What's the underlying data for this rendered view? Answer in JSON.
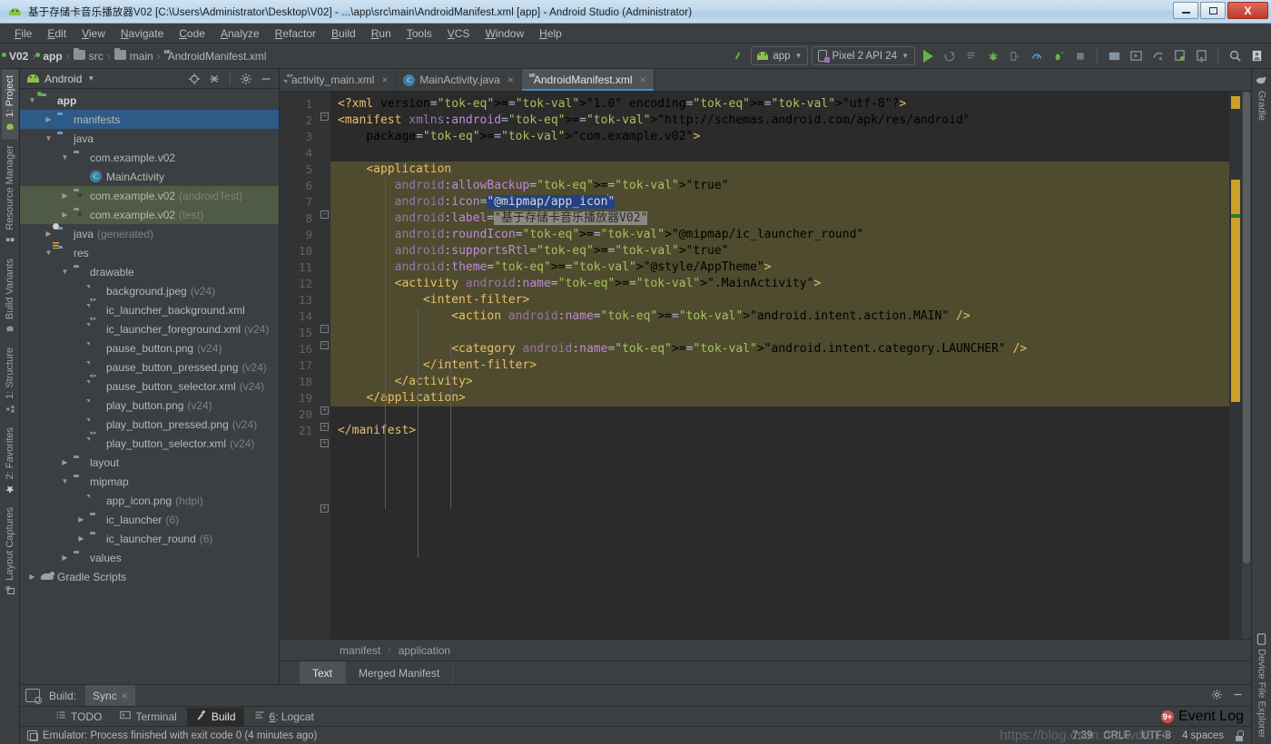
{
  "window": {
    "title": "基于存储卡音乐播放器V02 [C:\\Users\\Administrator\\Desktop\\V02] - ...\\app\\src\\main\\AndroidManifest.xml [app] - Android Studio (Administrator)",
    "minimize_label": "",
    "maximize_label": "",
    "close_label": "X"
  },
  "menu": {
    "items": [
      "File",
      "Edit",
      "View",
      "Navigate",
      "Code",
      "Analyze",
      "Refactor",
      "Build",
      "Run",
      "Tools",
      "VCS",
      "Window",
      "Help"
    ]
  },
  "toolbar": {
    "breadcrumbs": [
      {
        "label": "V02",
        "icon": "module-icon",
        "bold": true
      },
      {
        "label": "app",
        "icon": "module-icon",
        "bold": true
      },
      {
        "label": "src",
        "icon": "folder-icon",
        "bold": false
      },
      {
        "label": "main",
        "icon": "folder-icon",
        "bold": false
      },
      {
        "label": "AndroidManifest.xml",
        "icon": "manifest-icon",
        "bold": false
      }
    ],
    "separator": "›",
    "run_config": "app",
    "device": "Pixel 2 API 24",
    "caret": "▼",
    "icons": [
      "make-project-icon",
      "run-icon",
      "apply-changes-icon",
      "apply-code-changes-icon",
      "debug-icon",
      "attach-debugger-icon",
      "profile-icon",
      "run-coverage-icon",
      "stop-icon",
      "sdk-manager-icon",
      "avd-manager-icon",
      "sync-gradle-icon",
      "device-manager-icon",
      "layout-inspector-icon",
      "search-icon",
      "user-icon"
    ]
  },
  "left_toolbar": {
    "tabs": [
      {
        "label": "1: Project",
        "icon": "project-icon",
        "selected": true
      },
      {
        "label": "Resource Manager",
        "icon": "resource-icon",
        "selected": false
      },
      {
        "label": "Build Variants",
        "icon": "variants-icon",
        "selected": false
      },
      {
        "label": "1: Structure",
        "icon": "structure-icon",
        "selected": false
      },
      {
        "label": "2: Favorites",
        "icon": "star-icon",
        "selected": false
      },
      {
        "label": "Layout Captures",
        "icon": "capture-icon",
        "selected": false
      }
    ]
  },
  "right_toolbar": {
    "tabs": [
      {
        "label": "Gradle",
        "icon": "gradle-icon"
      },
      {
        "label": "Device File Explorer",
        "icon": "device-icon"
      }
    ]
  },
  "project_panel": {
    "title": "Android",
    "caret": "▼",
    "header_icons": [
      "locate-icon",
      "collapse-all-icon",
      "settings-gear-icon",
      "hide-icon"
    ],
    "tree": [
      {
        "indent": 0,
        "arrow": "▼",
        "icon": "module-icon",
        "label": "app",
        "hint": "",
        "bold": true,
        "state": "none"
      },
      {
        "indent": 1,
        "arrow": "▶",
        "icon": "folder-icon",
        "label": "manifests",
        "hint": "",
        "bold": false,
        "state": "selected-blue"
      },
      {
        "indent": 1,
        "arrow": "▼",
        "icon": "folder-icon",
        "label": "java",
        "hint": "",
        "bold": false,
        "state": "none"
      },
      {
        "indent": 2,
        "arrow": "▼",
        "icon": "package-icon",
        "label": "com.example.v02",
        "hint": "",
        "bold": false,
        "state": "none"
      },
      {
        "indent": 3,
        "arrow": "",
        "icon": "class-icon",
        "label": "MainActivity",
        "hint": "",
        "bold": false,
        "state": "none"
      },
      {
        "indent": 2,
        "arrow": "▶",
        "icon": "package-icon",
        "label": "com.example.v02",
        "hint": "(androidTest)",
        "bold": false,
        "state": "selected-green"
      },
      {
        "indent": 2,
        "arrow": "▶",
        "icon": "package-icon",
        "label": "com.example.v02",
        "hint": "(test)",
        "bold": false,
        "state": "selected-green"
      },
      {
        "indent": 1,
        "arrow": "▶",
        "icon": "generated-icon",
        "label": "java",
        "hint": "(generated)",
        "bold": false,
        "state": "none"
      },
      {
        "indent": 1,
        "arrow": "▼",
        "icon": "res-icon",
        "label": "res",
        "hint": "",
        "bold": false,
        "state": "none"
      },
      {
        "indent": 2,
        "arrow": "▼",
        "icon": "package-icon",
        "label": "drawable",
        "hint": "",
        "bold": false,
        "state": "none"
      },
      {
        "indent": 3,
        "arrow": "",
        "icon": "image-file-icon",
        "label": "background.jpeg",
        "hint": "(v24)",
        "bold": false,
        "state": "none"
      },
      {
        "indent": 3,
        "arrow": "",
        "icon": "xml-file-icon",
        "label": "ic_launcher_background.xml",
        "hint": "",
        "bold": false,
        "state": "none"
      },
      {
        "indent": 3,
        "arrow": "",
        "icon": "xml-file-icon",
        "label": "ic_launcher_foreground.xml",
        "hint": "(v24)",
        "bold": false,
        "state": "none"
      },
      {
        "indent": 3,
        "arrow": "",
        "icon": "image-file-icon",
        "label": "pause_button.png",
        "hint": "(v24)",
        "bold": false,
        "state": "none"
      },
      {
        "indent": 3,
        "arrow": "",
        "icon": "image-file-icon",
        "label": "pause_button_pressed.png",
        "hint": "(v24)",
        "bold": false,
        "state": "none"
      },
      {
        "indent": 3,
        "arrow": "",
        "icon": "xml-file-icon",
        "label": "pause_button_selector.xml",
        "hint": "(v24)",
        "bold": false,
        "state": "none"
      },
      {
        "indent": 3,
        "arrow": "",
        "icon": "image-file-icon",
        "label": "play_button.png",
        "hint": "(v24)",
        "bold": false,
        "state": "none"
      },
      {
        "indent": 3,
        "arrow": "",
        "icon": "image-file-icon",
        "label": "play_button_pressed.png",
        "hint": "(v24)",
        "bold": false,
        "state": "none"
      },
      {
        "indent": 3,
        "arrow": "",
        "icon": "xml-file-icon",
        "label": "play_button_selector.xml",
        "hint": "(v24)",
        "bold": false,
        "state": "none"
      },
      {
        "indent": 2,
        "arrow": "▶",
        "icon": "package-icon",
        "label": "layout",
        "hint": "",
        "bold": false,
        "state": "none"
      },
      {
        "indent": 2,
        "arrow": "▼",
        "icon": "package-icon",
        "label": "mipmap",
        "hint": "",
        "bold": false,
        "state": "none"
      },
      {
        "indent": 3,
        "arrow": "",
        "icon": "image-file-icon",
        "label": "app_icon.png",
        "hint": "(hdpi)",
        "bold": false,
        "state": "none"
      },
      {
        "indent": 3,
        "arrow": "▶",
        "icon": "package-icon",
        "label": "ic_launcher",
        "hint": "(6)",
        "bold": false,
        "state": "none"
      },
      {
        "indent": 3,
        "arrow": "▶",
        "icon": "package-icon",
        "label": "ic_launcher_round",
        "hint": "(6)",
        "bold": false,
        "state": "none"
      },
      {
        "indent": 2,
        "arrow": "▶",
        "icon": "package-icon",
        "label": "values",
        "hint": "",
        "bold": false,
        "state": "none"
      },
      {
        "indent": 0,
        "arrow": "▶",
        "icon": "gradle-icon",
        "label": "Gradle Scripts",
        "hint": "",
        "bold": false,
        "state": "none"
      }
    ]
  },
  "editor": {
    "tabs": [
      {
        "label": "activity_main.xml",
        "icon": "xml-file-icon",
        "active": false,
        "close": "×"
      },
      {
        "label": "MainActivity.java",
        "icon": "class-icon",
        "active": false,
        "close": "×"
      },
      {
        "label": "AndroidManifest.xml",
        "icon": "manifest-icon",
        "active": true,
        "close": "×"
      }
    ],
    "line_numbers": [
      "1",
      "2",
      "3",
      "4",
      "5",
      "6",
      "7",
      "8",
      "9",
      "10",
      "11",
      "12",
      "13",
      "14",
      "15",
      "16",
      "17",
      "18",
      "19",
      "20",
      "21"
    ],
    "code_lines": [
      "<?xml version=\"1.0\" encoding=\"utf-8\"?>",
      "<manifest xmlns:android=\"http://schemas.android.com/apk/res/android\"",
      "    package=\"com.example.v02\">",
      "",
      "    <application",
      "        android:allowBackup=\"true\"",
      "        android:icon=\"@mipmap/app_icon\"",
      "        android:label=\"基于存储卡音乐播放器V02\"",
      "        android:roundIcon=\"@mipmap/ic_launcher_round\"",
      "        android:supportsRtl=\"true\"",
      "        android:theme=\"@style/AppTheme\">",
      "        <activity android:name=\".MainActivity\">",
      "            <intent-filter>",
      "                <action android:name=\"android.intent.action.MAIN\" />",
      "",
      "                <category android:name=\"android.intent.category.LAUNCHER\" />",
      "            </intent-filter>",
      "        </activity>",
      "    </application>",
      "",
      "</manifest>"
    ],
    "selected_text": "@mipmap/app_icon",
    "tooltip_text": "\"基于存储卡音乐播放器V02\"",
    "breadcrumb": [
      "manifest",
      "application"
    ],
    "breadcrumb_sep": "›",
    "bottom_tabs": [
      {
        "label": "Text",
        "active": true
      },
      {
        "label": "Merged Manifest",
        "active": false
      }
    ]
  },
  "build_panel": {
    "label": "Build:",
    "tab": "Sync",
    "close": "×",
    "settings_icon": "gear-icon",
    "hide_icon": "hide-icon"
  },
  "tool_windows": {
    "items": [
      {
        "label": "TODO",
        "icon": "todo-icon",
        "active": false
      },
      {
        "label": "Terminal",
        "icon": "terminal-icon",
        "active": false
      },
      {
        "label": "Build",
        "icon": "build-hammer-icon",
        "active": true
      },
      {
        "label": "6: Logcat",
        "icon": "logcat-icon",
        "active": false
      }
    ],
    "event_log": "Event Log",
    "event_badge": "9+"
  },
  "status_bar": {
    "message": "Emulator: Process finished with exit code 0 (4 minutes ago)",
    "caret_position": "7:39",
    "line_separator": "CRLF",
    "encoding": "UTF-8",
    "indent": "4 spaces",
    "lock_icon": "lock-icon",
    "watermark": "https://blog.csdn.net/wdt816"
  },
  "colors": {
    "accent_blue": "#4a88c7",
    "selection_blue": "#2e5a87",
    "selection_green": "#4f5b45",
    "highlight_yellow": "#4f4b2e",
    "panel_bg": "#3c3f41",
    "editor_bg": "#2b2b2b",
    "green_run": "#62b543",
    "error_red": "#c75450"
  }
}
